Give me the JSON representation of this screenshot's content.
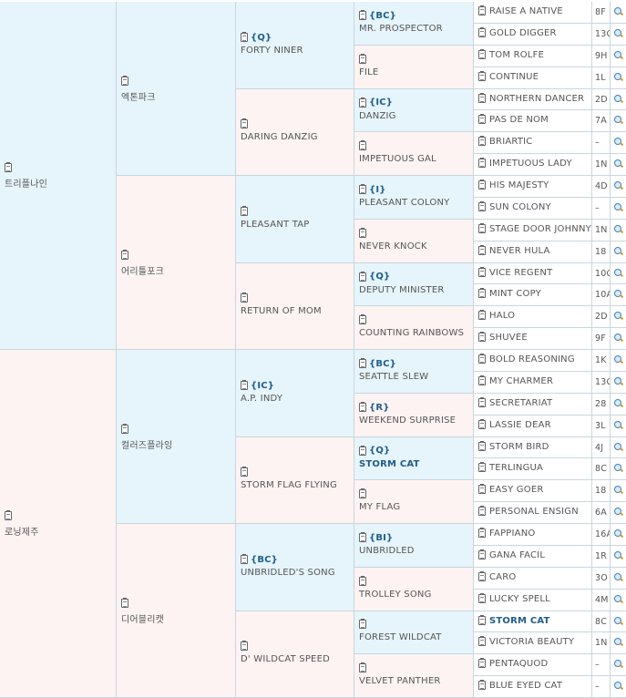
{
  "pedigree": {
    "gen1": [
      {
        "name": "트리플나인"
      },
      {
        "name": "로닝제주"
      }
    ],
    "gen2": [
      {
        "name": "엑톤파크"
      },
      {
        "name": "어리틀포크"
      },
      {
        "name": "컬러즈플라잉"
      },
      {
        "name": "디어블리캣"
      }
    ],
    "gen3": [
      {
        "tag": "{Q}",
        "name": "FORTY NINER"
      },
      {
        "name": "DARING DANZIG"
      },
      {
        "name": "PLEASANT TAP"
      },
      {
        "name": "RETURN OF MOM"
      },
      {
        "tag": "{IC}",
        "name": "A.P. INDY"
      },
      {
        "name": "STORM FLAG FLYING"
      },
      {
        "tag": "{BC}",
        "name": "UNBRIDLED'S SONG"
      },
      {
        "name": "D' WILDCAT SPEED"
      }
    ],
    "gen4": [
      {
        "tag": "{BC}",
        "name": "MR. PROSPECTOR"
      },
      {
        "name": "FILE"
      },
      {
        "tag": "{IC}",
        "name": "DANZIG"
      },
      {
        "name": "IMPETUOUS GAL"
      },
      {
        "tag": "{I}",
        "name": "PLEASANT COLONY"
      },
      {
        "name": "NEVER KNOCK"
      },
      {
        "tag": "{Q}",
        "name": "DEPUTY MINISTER"
      },
      {
        "name": "COUNTING RAINBOWS"
      },
      {
        "tag": "{BC}",
        "name": "SEATTLE SLEW"
      },
      {
        "tag": "{R}",
        "name": "WEEKEND SURPRISE"
      },
      {
        "tag": "{Q}",
        "name": "STORM CAT"
      },
      {
        "name": "MY FLAG"
      },
      {
        "tag": "{BI}",
        "name": "UNBRIDLED"
      },
      {
        "name": "TROLLEY SONG"
      },
      {
        "name": "FOREST WILDCAT"
      },
      {
        "name": "VELVET PANTHER"
      }
    ],
    "gen5": [
      {
        "name": "RAISE A NATIVE",
        "code": "8F"
      },
      {
        "name": "GOLD DIGGER",
        "code": "13C"
      },
      {
        "name": "TOM ROLFE",
        "code": "9H"
      },
      {
        "name": "CONTINUE",
        "code": "1L"
      },
      {
        "name": "NORTHERN DANCER",
        "code": "2D"
      },
      {
        "name": "PAS DE NOM",
        "code": "7A"
      },
      {
        "name": "BRIARTIC",
        "code": "–"
      },
      {
        "name": "IMPETUOUS LADY",
        "code": "1N"
      },
      {
        "name": "HIS MAJESTY",
        "code": "4D"
      },
      {
        "name": "SUN COLONY",
        "code": "–"
      },
      {
        "name": "STAGE DOOR JOHNNY",
        "code": "1N"
      },
      {
        "name": "NEVER HULA",
        "code": "18"
      },
      {
        "name": "VICE REGENT",
        "code": "10C"
      },
      {
        "name": "MINT COPY",
        "code": "10A"
      },
      {
        "name": "HALO",
        "code": "2D"
      },
      {
        "name": "SHUVEE",
        "code": "9F"
      },
      {
        "name": "BOLD REASONING",
        "code": "1K"
      },
      {
        "name": "MY CHARMER",
        "code": "13C"
      },
      {
        "name": "SECRETARIAT",
        "code": "28"
      },
      {
        "name": "LASSIE DEAR",
        "code": "3L"
      },
      {
        "name": "STORM BIRD",
        "code": "4J"
      },
      {
        "name": "TERLINGUA",
        "code": "8C"
      },
      {
        "name": "EASY GOER",
        "code": "18"
      },
      {
        "name": "PERSONAL ENSIGN",
        "code": "6A"
      },
      {
        "name": "FAPPIANO",
        "code": "16A"
      },
      {
        "name": "GANA FACIL",
        "code": "1R"
      },
      {
        "name": "CARO",
        "code": "3O"
      },
      {
        "name": "LUCKY SPELL",
        "code": "4M"
      },
      {
        "name": "STORM CAT",
        "code": "8C"
      },
      {
        "name": "VICTORIA BEAUTY",
        "code": "1N"
      },
      {
        "name": "PENTAQUOD",
        "code": "–"
      },
      {
        "name": "BLUE EYED CAT",
        "code": "–"
      }
    ]
  },
  "highlights": {
    "bold_names": [
      "STORM CAT"
    ]
  },
  "colors": {
    "sire_bg": "#e6f4fb",
    "dam_bg": "#fdf3f3",
    "border": "#c9d6dd",
    "tag_blue": "#1d5f8c"
  },
  "icons": {
    "horse_info": "document-icon",
    "search": "magnifier-icon"
  }
}
